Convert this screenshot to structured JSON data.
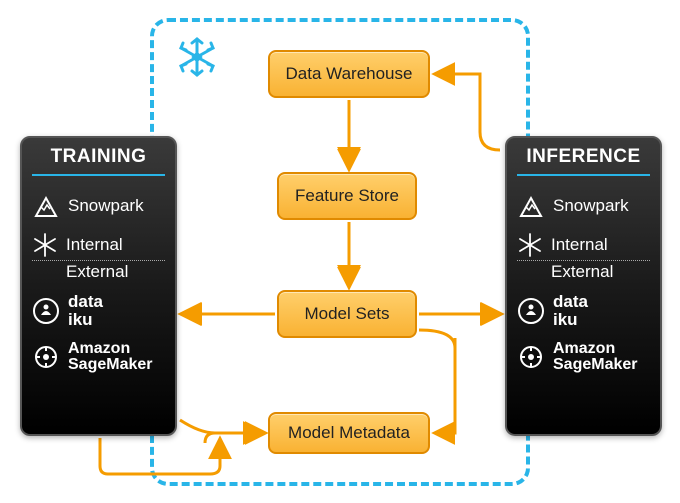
{
  "diagram": {
    "container_icon": "snowflake-logo",
    "nodes": {
      "data_warehouse": "Data Warehouse",
      "feature_store": "Feature Store",
      "model_sets": "Model Sets",
      "model_metadata": "Model Metadata"
    },
    "panels": {
      "training": {
        "title": "TRAINING",
        "items": {
          "snowpark": "Snowpark",
          "internal": "Internal",
          "external": "External",
          "dataiku_line1": "data",
          "dataiku_line2": "iku",
          "sagemaker_line1": "Amazon",
          "sagemaker_line2": "SageMaker"
        }
      },
      "inference": {
        "title": "INFERENCE",
        "items": {
          "snowpark": "Snowpark",
          "internal": "Internal",
          "external": "External",
          "dataiku_line1": "data",
          "dataiku_line2": "iku",
          "sagemaker_line1": "Amazon",
          "sagemaker_line2": "SageMaker"
        }
      }
    },
    "edges": [
      {
        "from": "data_warehouse",
        "to": "feature_store",
        "direction": "down"
      },
      {
        "from": "feature_store",
        "to": "model_sets",
        "direction": "down"
      },
      {
        "from": "model_sets",
        "to": "training_panel",
        "direction": "left"
      },
      {
        "from": "model_sets",
        "to": "inference_panel",
        "direction": "right"
      },
      {
        "from": "training_panel",
        "to": "model_metadata",
        "direction": "down-right"
      },
      {
        "from": "model_sets",
        "to": "model_metadata",
        "direction": "down",
        "via_inference": true
      },
      {
        "from": "inference_panel",
        "to": "data_warehouse",
        "direction": "up-left"
      }
    ],
    "colors": {
      "accent_blue": "#29b5e8",
      "box_fill_top": "#ffcf6b",
      "box_fill_bottom": "#f9b233",
      "box_border": "#e08a00",
      "arrow": "#f59c00",
      "panel_bg": "#1a1a1a"
    }
  }
}
